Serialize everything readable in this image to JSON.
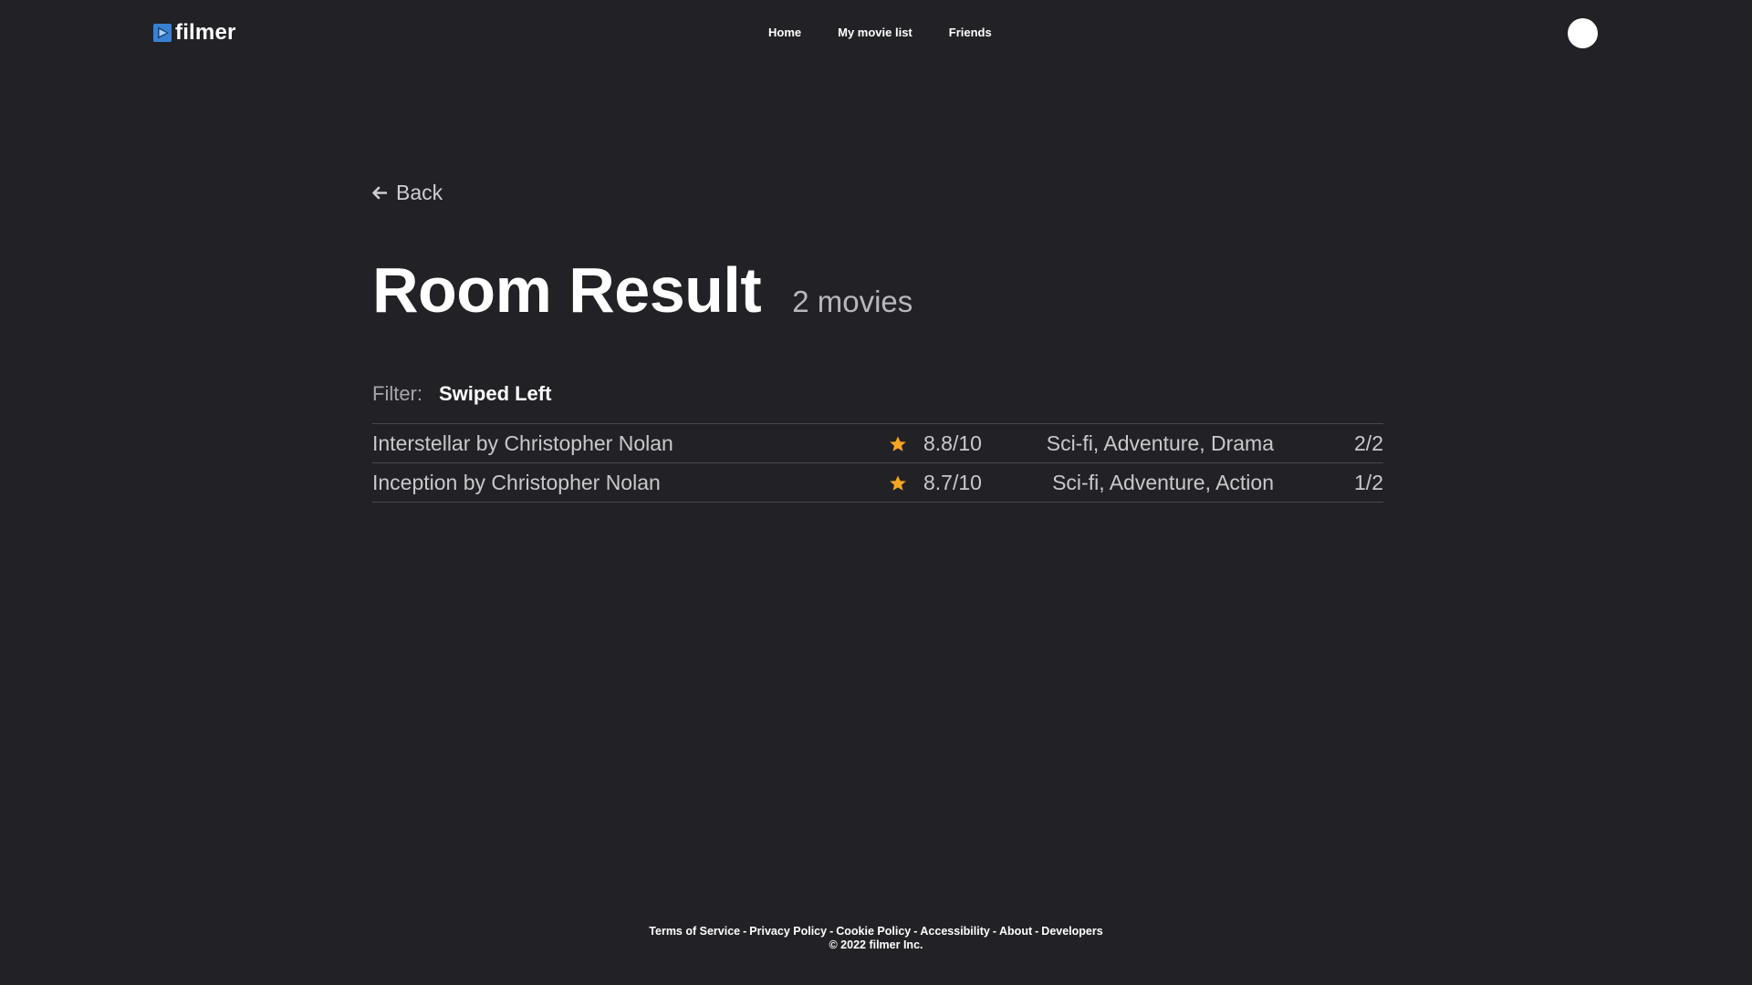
{
  "header": {
    "logo_text": "filmer",
    "logo_icon": "play-icon",
    "nav": [
      {
        "label": "Home"
      },
      {
        "label": "My movie list"
      },
      {
        "label": "Friends"
      }
    ]
  },
  "main": {
    "back_label": "Back",
    "title": "Room Result",
    "count_label": "2 movies",
    "filter_label": "Filter:",
    "filter_value": "Swiped Left",
    "movies": [
      {
        "title": "Interstellar by Christopher Nolan",
        "rating": "8.8/10",
        "genres": "Sci-fi, Adventure, Drama",
        "votes": "2/2"
      },
      {
        "title": "Inception by Christopher Nolan",
        "rating": "8.7/10",
        "genres": "Sci-fi, Adventure, Action",
        "votes": "1/2"
      }
    ]
  },
  "footer": {
    "links": [
      {
        "label": "Terms of Service"
      },
      {
        "label": "Privacy Policy"
      },
      {
        "label": "Cookie Policy"
      },
      {
        "label": "Accessibility"
      },
      {
        "label": "About"
      },
      {
        "label": "Developers"
      }
    ],
    "copyright": "© 2022 filmer Inc."
  },
  "colors": {
    "background": "#222226",
    "star": "#f5a524",
    "logo_blue": "#3f8fe8",
    "divider": "#48484d"
  }
}
